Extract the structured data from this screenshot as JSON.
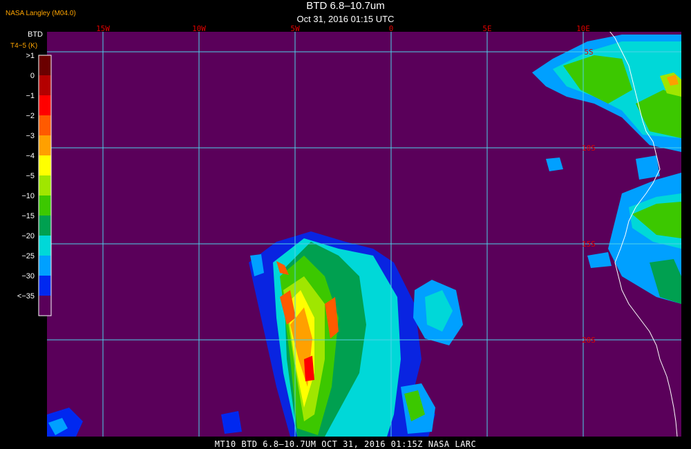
{
  "header": {
    "credit": "NASA Langley (M04.0)",
    "title": "BTD 6.8–10.7um",
    "subtitle": "Oct 31, 2016 01:15 UTC"
  },
  "colorbar": {
    "title_line1": "BTD",
    "title_line2": "T4−5 (K)",
    "labels": [
      ">1",
      "0",
      "−1",
      "−2",
      "−3",
      "−4",
      "−5",
      "−10",
      "−15",
      "−20",
      "−25",
      "−30",
      "<−35"
    ],
    "colors": [
      "#6b0000",
      "#b40000",
      "#ff0000",
      "#ff5a00",
      "#ffa000",
      "#ffff00",
      "#a0e600",
      "#3cc800",
      "#00a050",
      "#00d8d8",
      "#00a0ff",
      "#0028f0",
      "#5a005a"
    ]
  },
  "map": {
    "background_color": "#5a005a",
    "grid_color": "#4fd3e8",
    "longitude_labels": [
      "15W",
      "10W",
      "5W",
      "0",
      "5E",
      "10E"
    ],
    "latitude_labels": [
      "5S",
      "10S",
      "15S",
      "20S"
    ],
    "longitudes": [
      -15,
      -10,
      -5,
      0,
      5,
      10
    ],
    "latitudes": [
      -5,
      -10,
      -15,
      -20
    ],
    "label_color": "#e00000",
    "coastline_color": "#ffffff"
  },
  "footer": {
    "text": "MT10   BTD 6.8–10.7UM    OCT 31, 2016 01:15Z   NASA LARC"
  }
}
